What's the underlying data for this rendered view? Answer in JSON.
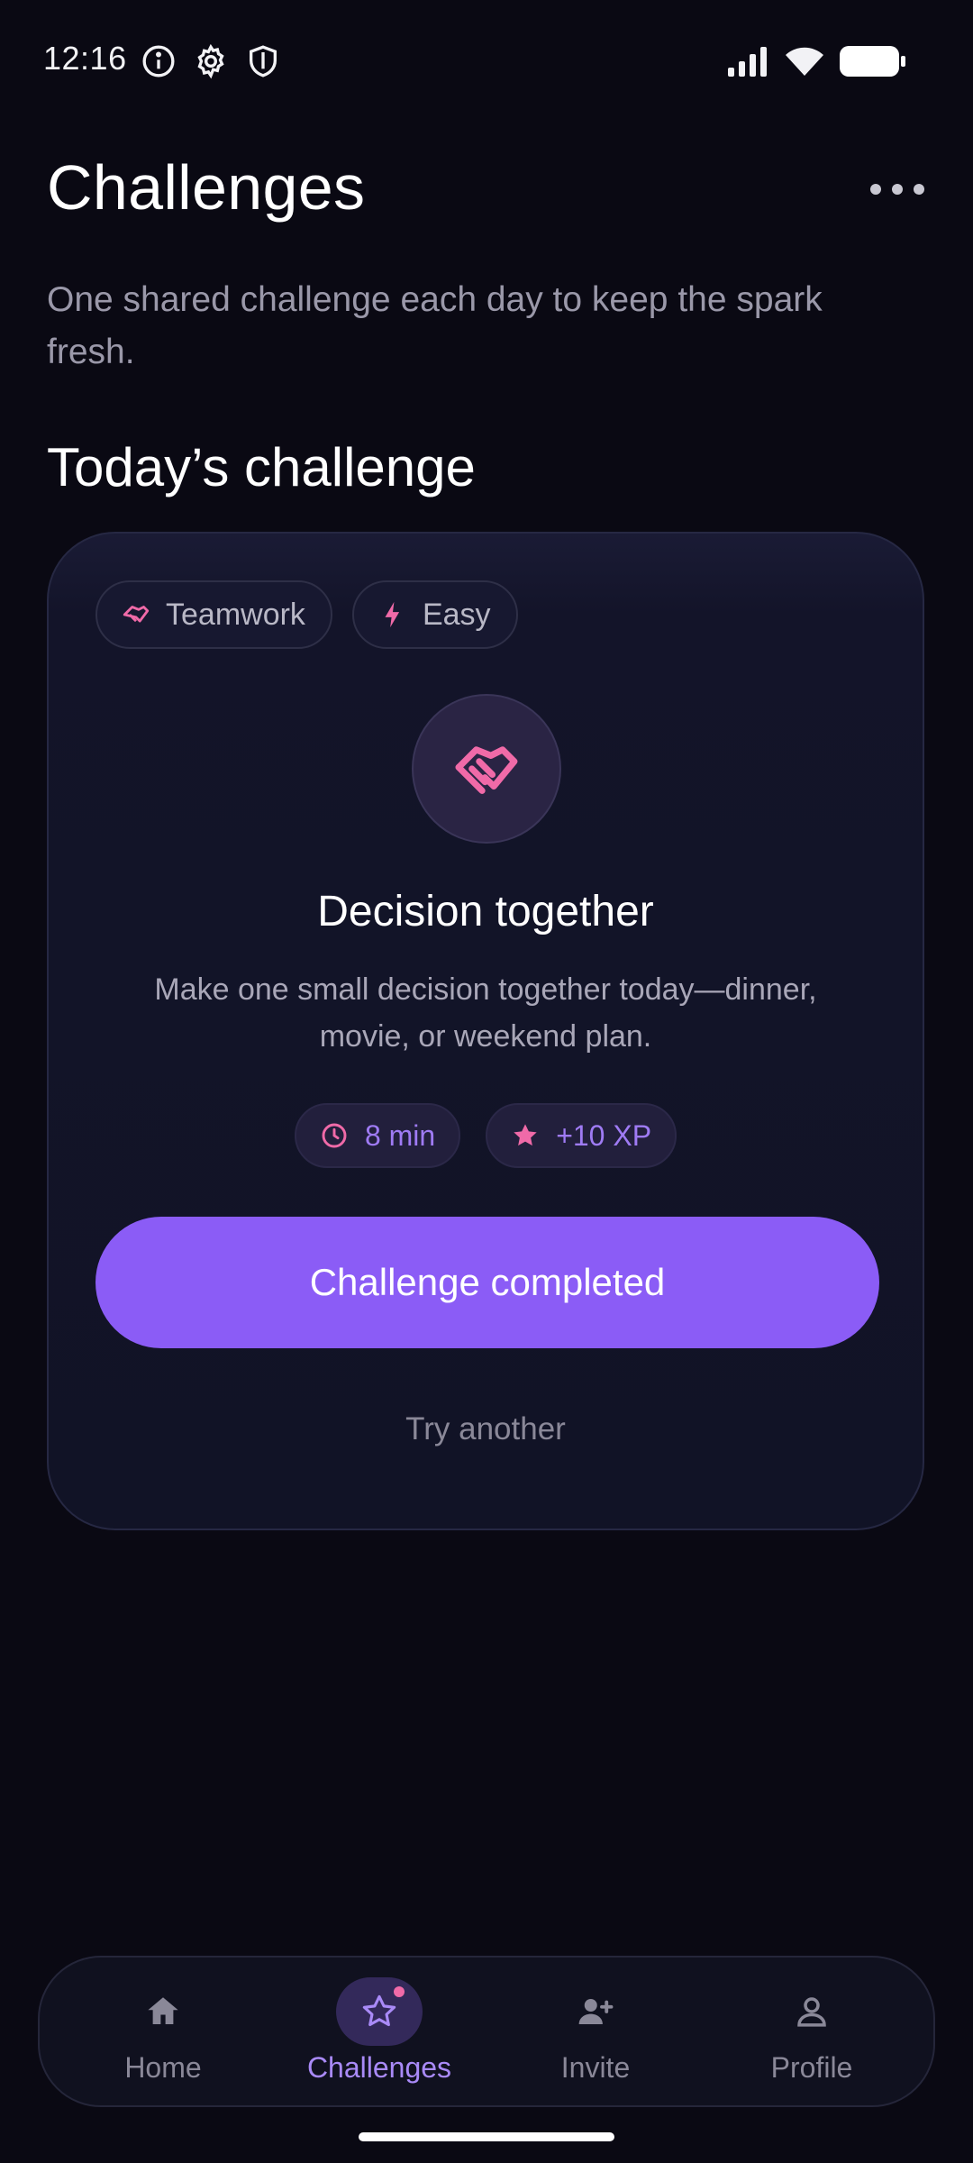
{
  "status_bar": {
    "time": "12:16",
    "left_icons": [
      "info-icon",
      "settings-icon",
      "shield-icon"
    ],
    "right_icons": [
      "signal-icon",
      "wifi-icon",
      "battery-icon"
    ]
  },
  "header": {
    "title": "Challenges",
    "subtitle": "One shared challenge each day to keep the spark fresh."
  },
  "section": {
    "title": "Today’s challenge"
  },
  "challenge": {
    "tags": [
      {
        "label": "Teamwork",
        "icon": "handshake-icon"
      },
      {
        "label": "Easy",
        "icon": "bolt-icon"
      }
    ],
    "hero_icon": "handshake-icon",
    "title": "Decision together",
    "description": "Make one small decision together today—dinner, movie, or weekend plan.",
    "duration": "8 min",
    "reward": "+10 XP",
    "primary_action": "Challenge completed",
    "secondary_action": "Try another"
  },
  "nav": {
    "items": [
      {
        "label": "Home",
        "icon": "home-icon",
        "active": false
      },
      {
        "label": "Challenges",
        "icon": "star-icon",
        "active": true
      },
      {
        "label": "Invite",
        "icon": "add-person-icon",
        "active": false
      },
      {
        "label": "Profile",
        "icon": "person-icon",
        "active": false
      }
    ]
  },
  "colors": {
    "background": "#0a0913",
    "accent": "#8b5cf6",
    "pink": "#f06aa8",
    "muted_text": "#9a98a9"
  }
}
